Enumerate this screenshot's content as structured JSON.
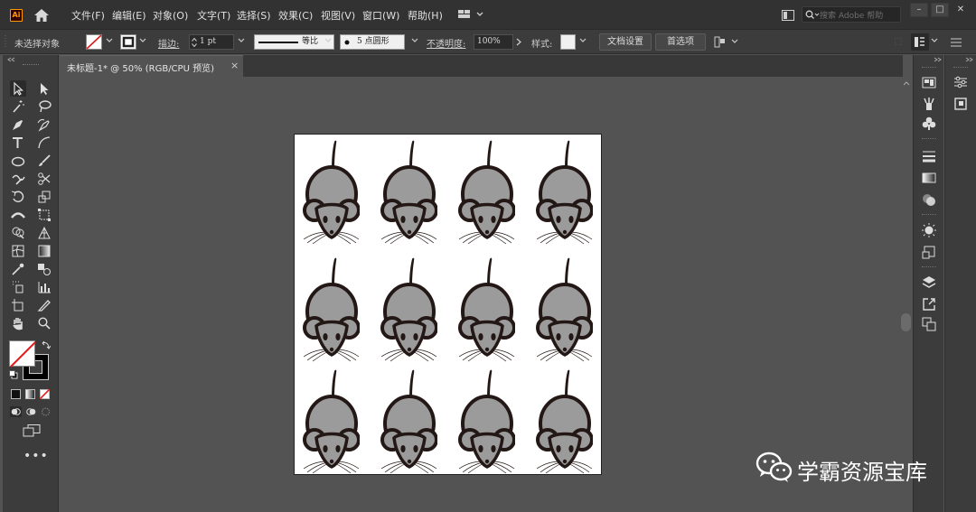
{
  "app": {
    "logo_text": "Ai",
    "menu": [
      "文件(F)",
      "编辑(E)",
      "对象(O)",
      "文字(T)",
      "选择(S)",
      "效果(C)",
      "视图(V)",
      "窗口(W)",
      "帮助(H)"
    ],
    "search_placeholder": "搜索 Adobe 帮助",
    "window_buttons": [
      "–",
      "□",
      "✕"
    ]
  },
  "control_bar": {
    "selection_status": "未选择对象",
    "stroke_label": "描边:",
    "stroke_value": "1 pt",
    "stroke_profile": "等比",
    "brush_label": "5 点圆形",
    "opacity_label": "不透明度:",
    "opacity_value": "100%",
    "style_label": "样式:",
    "doc_setup_button": "文档设置",
    "preferences_button": "首选项"
  },
  "document_tab": {
    "title": "未标题-1* @ 50% (RGB/CPU 预览)",
    "close": "×"
  },
  "artboard": {
    "rows": 3,
    "columns": 4,
    "item": "mouse",
    "mouse_body_color": "#9b9b9b",
    "outline_color": "#231815"
  },
  "colors": {
    "menubar": "#323232",
    "panel": "#3c3c3c",
    "canvas": "#535353",
    "artboard": "#ffffff",
    "accent_logo": "#ff9a00"
  },
  "watermark": {
    "text": "学霸资源宝库"
  }
}
